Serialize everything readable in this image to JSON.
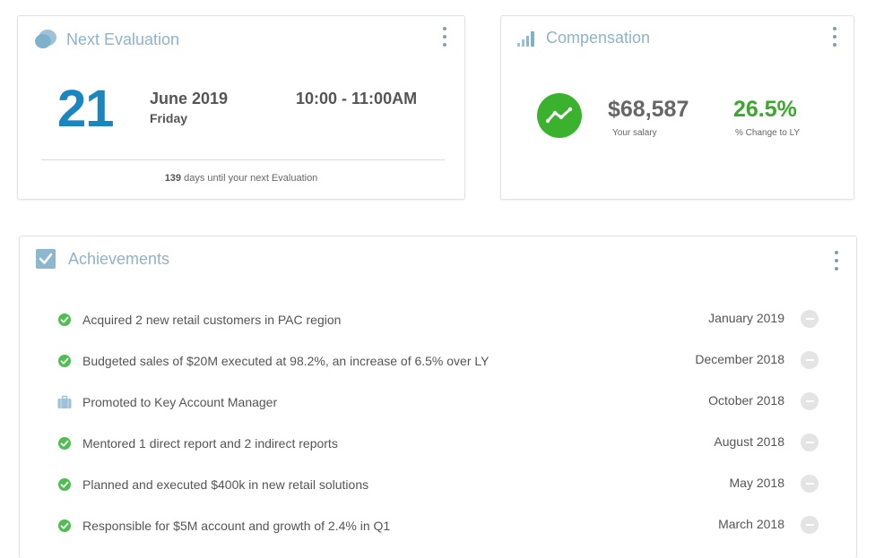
{
  "evaluation": {
    "title": "Next Evaluation",
    "icon": "chat-bubble-icon",
    "day": "21",
    "month_year": "June 2019",
    "weekday": "Friday",
    "time_range": "10:00 - 11:00AM",
    "days_until": "139",
    "days_until_text": " days until your next Evaluation"
  },
  "compensation": {
    "title": "Compensation",
    "icon": "signal-bars-icon",
    "salary": "$68,587",
    "salary_label": "Your salary",
    "change": "26.5%",
    "change_label": "% Change to LY",
    "trend_icon": "trend-line-icon",
    "accent_color": "#3bb22d"
  },
  "achievements": {
    "title": "Achievements",
    "icon": "checkbox-icon",
    "items": [
      {
        "text": "Acquired 2 new retail customers in PAC region",
        "date": "January 2019",
        "icon": "check-circle-icon"
      },
      {
        "text": "Budgeted sales of $20M executed at 98.2%, an increase of 6.5% over LY",
        "date": "December 2018",
        "icon": "check-circle-icon"
      },
      {
        "text": "Promoted to Key Account Manager",
        "date": "October 2018",
        "icon": "briefcase-icon"
      },
      {
        "text": "Mentored 1 direct report and 2 indirect reports",
        "date": "August 2018",
        "icon": "check-circle-icon"
      },
      {
        "text": "Planned and executed $400k in new retail solutions",
        "date": "May 2018",
        "icon": "check-circle-icon"
      },
      {
        "text": "Responsible for $5M account and growth of 2.4% in Q1",
        "date": "March 2018",
        "icon": "check-circle-icon"
      }
    ]
  },
  "colors": {
    "title": "#8fb3c9",
    "date_accent": "#1a86bf",
    "success": "#3aa82a"
  }
}
